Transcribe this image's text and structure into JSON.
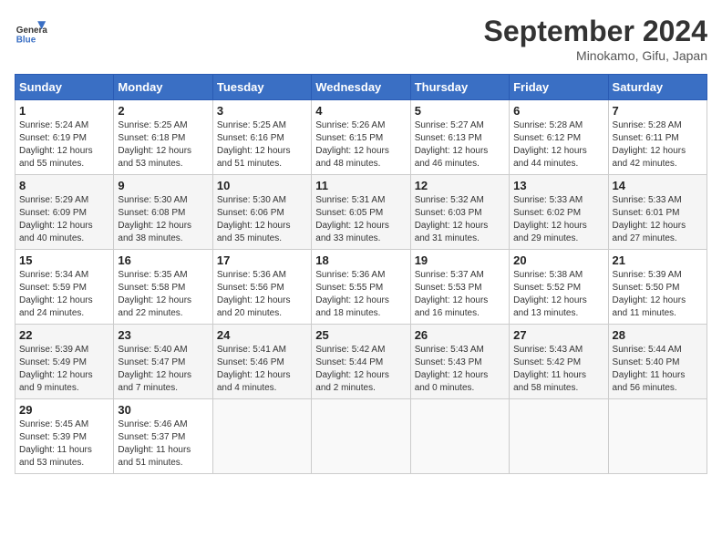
{
  "header": {
    "logo_line1": "General",
    "logo_line2": "Blue",
    "month": "September 2024",
    "location": "Minokamo, Gifu, Japan"
  },
  "weekdays": [
    "Sunday",
    "Monday",
    "Tuesday",
    "Wednesday",
    "Thursday",
    "Friday",
    "Saturday"
  ],
  "weeks": [
    [
      {
        "day": "1",
        "info": "Sunrise: 5:24 AM\nSunset: 6:19 PM\nDaylight: 12 hours\nand 55 minutes."
      },
      {
        "day": "2",
        "info": "Sunrise: 5:25 AM\nSunset: 6:18 PM\nDaylight: 12 hours\nand 53 minutes."
      },
      {
        "day": "3",
        "info": "Sunrise: 5:25 AM\nSunset: 6:16 PM\nDaylight: 12 hours\nand 51 minutes."
      },
      {
        "day": "4",
        "info": "Sunrise: 5:26 AM\nSunset: 6:15 PM\nDaylight: 12 hours\nand 48 minutes."
      },
      {
        "day": "5",
        "info": "Sunrise: 5:27 AM\nSunset: 6:13 PM\nDaylight: 12 hours\nand 46 minutes."
      },
      {
        "day": "6",
        "info": "Sunrise: 5:28 AM\nSunset: 6:12 PM\nDaylight: 12 hours\nand 44 minutes."
      },
      {
        "day": "7",
        "info": "Sunrise: 5:28 AM\nSunset: 6:11 PM\nDaylight: 12 hours\nand 42 minutes."
      }
    ],
    [
      {
        "day": "8",
        "info": "Sunrise: 5:29 AM\nSunset: 6:09 PM\nDaylight: 12 hours\nand 40 minutes."
      },
      {
        "day": "9",
        "info": "Sunrise: 5:30 AM\nSunset: 6:08 PM\nDaylight: 12 hours\nand 38 minutes."
      },
      {
        "day": "10",
        "info": "Sunrise: 5:30 AM\nSunset: 6:06 PM\nDaylight: 12 hours\nand 35 minutes."
      },
      {
        "day": "11",
        "info": "Sunrise: 5:31 AM\nSunset: 6:05 PM\nDaylight: 12 hours\nand 33 minutes."
      },
      {
        "day": "12",
        "info": "Sunrise: 5:32 AM\nSunset: 6:03 PM\nDaylight: 12 hours\nand 31 minutes."
      },
      {
        "day": "13",
        "info": "Sunrise: 5:33 AM\nSunset: 6:02 PM\nDaylight: 12 hours\nand 29 minutes."
      },
      {
        "day": "14",
        "info": "Sunrise: 5:33 AM\nSunset: 6:01 PM\nDaylight: 12 hours\nand 27 minutes."
      }
    ],
    [
      {
        "day": "15",
        "info": "Sunrise: 5:34 AM\nSunset: 5:59 PM\nDaylight: 12 hours\nand 24 minutes."
      },
      {
        "day": "16",
        "info": "Sunrise: 5:35 AM\nSunset: 5:58 PM\nDaylight: 12 hours\nand 22 minutes."
      },
      {
        "day": "17",
        "info": "Sunrise: 5:36 AM\nSunset: 5:56 PM\nDaylight: 12 hours\nand 20 minutes."
      },
      {
        "day": "18",
        "info": "Sunrise: 5:36 AM\nSunset: 5:55 PM\nDaylight: 12 hours\nand 18 minutes."
      },
      {
        "day": "19",
        "info": "Sunrise: 5:37 AM\nSunset: 5:53 PM\nDaylight: 12 hours\nand 16 minutes."
      },
      {
        "day": "20",
        "info": "Sunrise: 5:38 AM\nSunset: 5:52 PM\nDaylight: 12 hours\nand 13 minutes."
      },
      {
        "day": "21",
        "info": "Sunrise: 5:39 AM\nSunset: 5:50 PM\nDaylight: 12 hours\nand 11 minutes."
      }
    ],
    [
      {
        "day": "22",
        "info": "Sunrise: 5:39 AM\nSunset: 5:49 PM\nDaylight: 12 hours\nand 9 minutes."
      },
      {
        "day": "23",
        "info": "Sunrise: 5:40 AM\nSunset: 5:47 PM\nDaylight: 12 hours\nand 7 minutes."
      },
      {
        "day": "24",
        "info": "Sunrise: 5:41 AM\nSunset: 5:46 PM\nDaylight: 12 hours\nand 4 minutes."
      },
      {
        "day": "25",
        "info": "Sunrise: 5:42 AM\nSunset: 5:44 PM\nDaylight: 12 hours\nand 2 minutes."
      },
      {
        "day": "26",
        "info": "Sunrise: 5:43 AM\nSunset: 5:43 PM\nDaylight: 12 hours\nand 0 minutes."
      },
      {
        "day": "27",
        "info": "Sunrise: 5:43 AM\nSunset: 5:42 PM\nDaylight: 11 hours\nand 58 minutes."
      },
      {
        "day": "28",
        "info": "Sunrise: 5:44 AM\nSunset: 5:40 PM\nDaylight: 11 hours\nand 56 minutes."
      }
    ],
    [
      {
        "day": "29",
        "info": "Sunrise: 5:45 AM\nSunset: 5:39 PM\nDaylight: 11 hours\nand 53 minutes."
      },
      {
        "day": "30",
        "info": "Sunrise: 5:46 AM\nSunset: 5:37 PM\nDaylight: 11 hours\nand 51 minutes."
      },
      {
        "day": "",
        "info": ""
      },
      {
        "day": "",
        "info": ""
      },
      {
        "day": "",
        "info": ""
      },
      {
        "day": "",
        "info": ""
      },
      {
        "day": "",
        "info": ""
      }
    ]
  ]
}
